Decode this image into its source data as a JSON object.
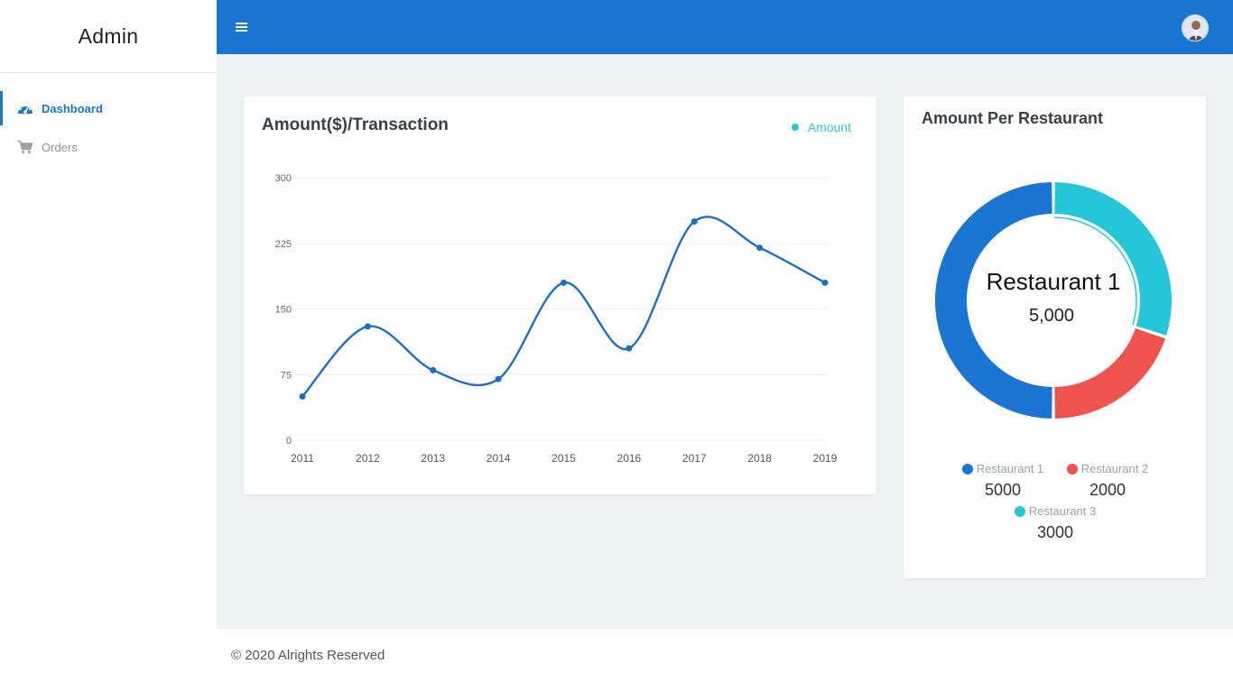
{
  "app": {
    "title": "Admin"
  },
  "sidebar": {
    "items": [
      {
        "label": "Dashboard",
        "icon": "dashboard-gauge-icon",
        "active": true
      },
      {
        "label": "Orders",
        "icon": "shopping-cart-icon",
        "active": false
      }
    ]
  },
  "topbar": {
    "menu_icon": "hamburger-menu-icon",
    "avatar": "user-avatar"
  },
  "line_card": {
    "title": "Amount($)/Transaction",
    "legend_label": "Amount"
  },
  "donut_card": {
    "title": "Amount Per Restaurant",
    "center_label": "Restaurant 1",
    "center_value": "5,000",
    "legend": [
      {
        "label": "Restaurant 1",
        "value": "5000",
        "color": "#1a76d2"
      },
      {
        "label": "Restaurant 2",
        "value": "2000",
        "color": "#ef5350"
      },
      {
        "label": "Restaurant 3",
        "value": "3000",
        "color": "#26c6da"
      }
    ]
  },
  "colors": {
    "primary": "#1a76d2",
    "line": "#1e6fc1",
    "accent": "#2bc5d8",
    "red": "#ef5350",
    "cyan": "#26c6da"
  },
  "footer": {
    "text": "© 2020 Alrights Reserved"
  },
  "chart_data": [
    {
      "type": "line",
      "title": "Amount($)/Transaction",
      "x": [
        "2011",
        "2012",
        "2013",
        "2014",
        "2015",
        "2016",
        "2017",
        "2018",
        "2019"
      ],
      "series": [
        {
          "name": "Amount",
          "values": [
            50,
            130,
            80,
            70,
            180,
            105,
            250,
            220,
            180
          ]
        }
      ],
      "ylim": [
        0,
        300
      ],
      "yticks": [
        0,
        75,
        150,
        225,
        300
      ],
      "grid": true,
      "legend": "top-right"
    },
    {
      "type": "pie",
      "title": "Amount Per Restaurant",
      "categories": [
        "Restaurant 1",
        "Restaurant 2",
        "Restaurant 3"
      ],
      "values": [
        5000,
        2000,
        3000
      ],
      "colors": [
        "#1a76d2",
        "#ef5350",
        "#26c6da"
      ],
      "style": "donut",
      "legend": "bottom"
    }
  ]
}
